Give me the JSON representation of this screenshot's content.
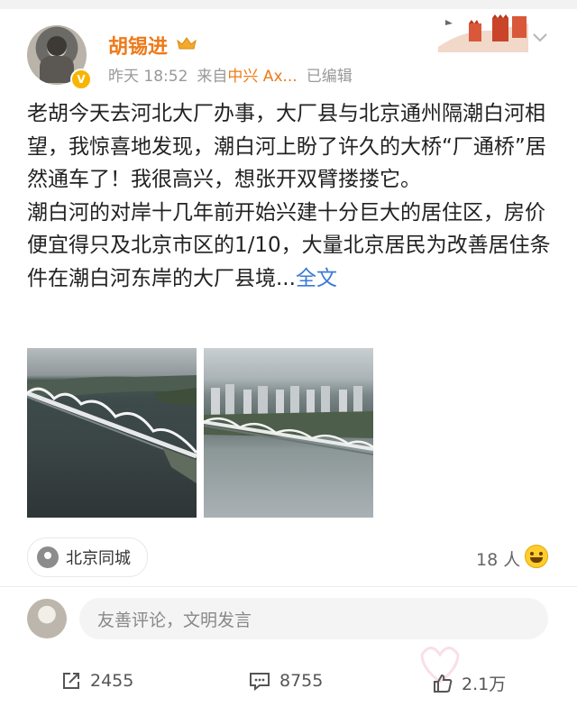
{
  "user": {
    "name": "胡锡进",
    "verified": true
  },
  "post": {
    "time": "昨天 18:52",
    "source_prefix": "来自",
    "source_app": "中兴 Ax...",
    "edited": "已编辑",
    "paragraph1": "老胡今天去河北大厂办事，大厂县与北京通州隔潮白河相望，我惊喜地发现，潮白河上盼了许久的大桥“厂通桥”居然通车了！我很高兴，想张开双臂搂搂它。",
    "paragraph2": "潮白河的对岸十几年前开始兴建十分巨大的居住区，房价便宜得只及北京市区的1/10，大量北京居民为改善居住条件在潮白河东岸的大厂县境...",
    "full_text_link": "全文"
  },
  "location": {
    "label": "北京同城"
  },
  "likes_summary": "18 人",
  "comment_placeholder": "友善评论，文明发言",
  "actions": {
    "repost_count": "2455",
    "comment_count": "8755",
    "like_count": "2.1万"
  },
  "colors": {
    "accent_orange": "#ee7a1a",
    "link_blue": "#3b7bd4",
    "text_gray": "#999999"
  }
}
